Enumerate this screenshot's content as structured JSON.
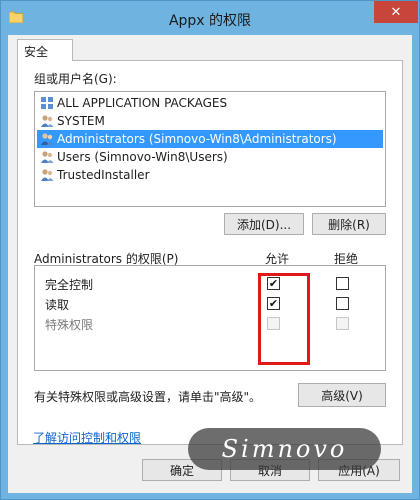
{
  "window": {
    "title": "Appx 的权限",
    "close_label": "✕"
  },
  "tab": {
    "label": "安全"
  },
  "groups": {
    "label": "组或用户名(G):",
    "items": [
      {
        "label": "ALL APPLICATION PACKAGES",
        "icon": "app-packages-icon",
        "selected": false
      },
      {
        "label": "SYSTEM",
        "icon": "user-group-icon",
        "selected": false
      },
      {
        "label": "Administrators (Simnovo-Win8\\Administrators)",
        "icon": "user-group-icon",
        "selected": true
      },
      {
        "label": "Users (Simnovo-Win8\\Users)",
        "icon": "user-group-icon",
        "selected": false
      },
      {
        "label": "TrustedInstaller",
        "icon": "user-group-icon",
        "selected": false
      }
    ]
  },
  "buttons": {
    "add": "添加(D)...",
    "remove": "删除(R)",
    "advanced": "高级(V)",
    "ok": "确定",
    "cancel": "取消",
    "apply": "应用(A)"
  },
  "permissions": {
    "label": "Administrators 的权限(P)",
    "allow_header": "允许",
    "deny_header": "拒绝",
    "rows": [
      {
        "name": "完全控制",
        "allow": true,
        "deny": false,
        "enabled": true
      },
      {
        "name": "读取",
        "allow": true,
        "deny": false,
        "enabled": true
      },
      {
        "name": "特殊权限",
        "allow": false,
        "deny": false,
        "enabled": false
      }
    ]
  },
  "advanced_hint": "有关特殊权限或高级设置，请单击\"高级\"。",
  "help_link": "了解访问控制和权限",
  "watermark": "Simnovo",
  "colors": {
    "selection": "#3399ff",
    "highlight_box": "#e01818",
    "title_bar": "#6fb3e0",
    "close_button": "#c7453b",
    "link": "#0b66cf"
  }
}
